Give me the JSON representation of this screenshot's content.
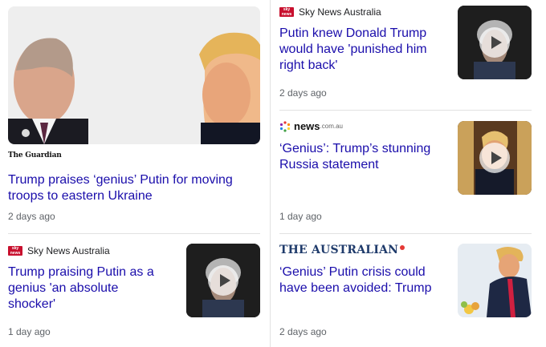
{
  "cards": {
    "main": {
      "source_logo": "The Guardian",
      "headline": "Trump praises ‘genius’ Putin for moving troops to eastern Ukraine",
      "age": "2 days ago"
    },
    "sky1": {
      "source": "Sky News Australia",
      "headline": "Putin knew Donald Trump would have 'punished him right back'",
      "age": "2 days ago"
    },
    "newsau": {
      "source_main": "news",
      "source_suffix": ".com.au",
      "headline": "‘Genius’: Trump’s stunning Russia statement",
      "age": "1 day ago"
    },
    "sky2": {
      "source": "Sky News Australia",
      "headline": "Trump praising Putin as a genius 'an absolute shocker'",
      "age": "1 day ago"
    },
    "australian": {
      "source_logo": "THE AUSTRALIAN",
      "headline": "‘Genius’ Putin crisis could have been avoided: Trump",
      "age": "2 days ago"
    }
  },
  "colors": {
    "headline": "#1a0dab",
    "meta": "#5f6368",
    "sky_red": "#c8102e",
    "australian_blue": "#1f3b6b"
  },
  "icons": [
    "play-icon",
    "sky-news-logo",
    "news-com-au-logo",
    "guardian-logo",
    "the-australian-logo"
  ]
}
